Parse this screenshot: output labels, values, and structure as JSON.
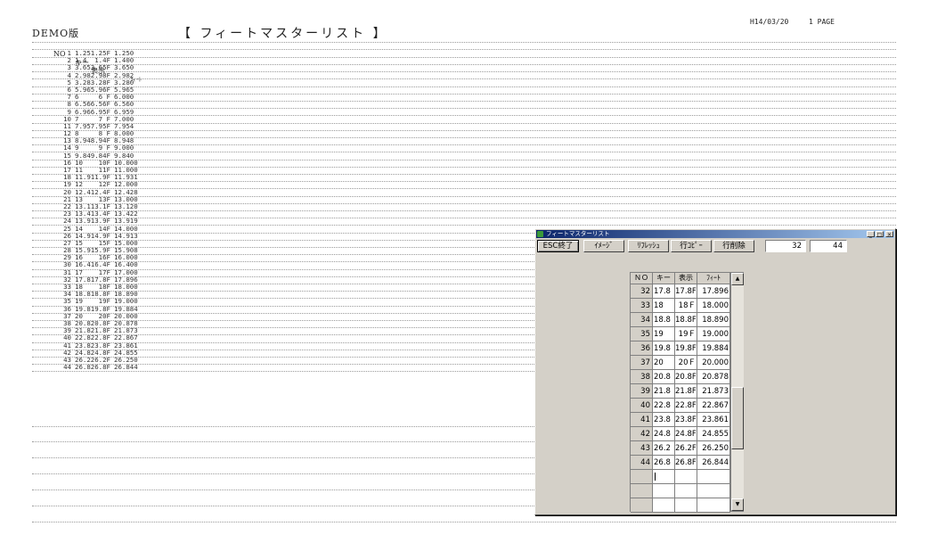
{
  "report": {
    "demo_label": "DEMO版",
    "title": "【 フィートマスターリスト 】",
    "date": "H14/03/20",
    "page": "1 PAGE",
    "headers": {
      "no": "NO",
      "key": "キー",
      "disp": "表示",
      "ft": "ﾌｨｰﾄ"
    },
    "rows": [
      {
        "no": "1",
        "key": "1.25",
        "disp": "1.25F",
        "ft": "1.250"
      },
      {
        "no": "2",
        "key": "1.4",
        "disp": "1.4F",
        "ft": "1.400"
      },
      {
        "no": "3",
        "key": "3.65",
        "disp": "3.65F",
        "ft": "3.650"
      },
      {
        "no": "4",
        "key": "2.98",
        "disp": "2.98F",
        "ft": "2.982"
      },
      {
        "no": "5",
        "key": "3.28",
        "disp": "3.28F",
        "ft": "3.280"
      },
      {
        "no": "6",
        "key": "5.96",
        "disp": "5.96F",
        "ft": "5.965"
      },
      {
        "no": "7",
        "key": "6",
        "disp": "6 F",
        "ft": "6.000"
      },
      {
        "no": "8",
        "key": "6.56",
        "disp": "6.56F",
        "ft": "6.560"
      },
      {
        "no": "9",
        "key": "6.96",
        "disp": "6.95F",
        "ft": "6.959"
      },
      {
        "no": "10",
        "key": "7",
        "disp": "7 F",
        "ft": "7.000"
      },
      {
        "no": "11",
        "key": "7.95",
        "disp": "7.95F",
        "ft": "7.954"
      },
      {
        "no": "12",
        "key": "8",
        "disp": "8 F",
        "ft": "8.000"
      },
      {
        "no": "13",
        "key": "8.94",
        "disp": "8.94F",
        "ft": "8.948"
      },
      {
        "no": "14",
        "key": "9",
        "disp": "9 F",
        "ft": "9.000"
      },
      {
        "no": "15",
        "key": "9.84",
        "disp": "9.84F",
        "ft": "9.840"
      },
      {
        "no": "16",
        "key": "10",
        "disp": "10F",
        "ft": "10.000"
      },
      {
        "no": "17",
        "key": "11",
        "disp": "11F",
        "ft": "11.000"
      },
      {
        "no": "18",
        "key": "11.9",
        "disp": "11.9F",
        "ft": "11.931"
      },
      {
        "no": "19",
        "key": "12",
        "disp": "12F",
        "ft": "12.000"
      },
      {
        "no": "20",
        "key": "12.4",
        "disp": "12.4F",
        "ft": "12.428"
      },
      {
        "no": "21",
        "key": "13",
        "disp": "13F",
        "ft": "13.000"
      },
      {
        "no": "22",
        "key": "13.1",
        "disp": "13.1F",
        "ft": "13.120"
      },
      {
        "no": "23",
        "key": "13.4",
        "disp": "13.4F",
        "ft": "13.422"
      },
      {
        "no": "24",
        "key": "13.9",
        "disp": "13.9F",
        "ft": "13.919"
      },
      {
        "no": "25",
        "key": "14",
        "disp": "14F",
        "ft": "14.000"
      },
      {
        "no": "26",
        "key": "14.9",
        "disp": "14.9F",
        "ft": "14.913"
      },
      {
        "no": "27",
        "key": "15",
        "disp": "15F",
        "ft": "15.000"
      },
      {
        "no": "28",
        "key": "15.9",
        "disp": "15.9F",
        "ft": "15.908"
      },
      {
        "no": "29",
        "key": "16",
        "disp": "16F",
        "ft": "16.000"
      },
      {
        "no": "30",
        "key": "16.4",
        "disp": "16.4F",
        "ft": "16.400"
      },
      {
        "no": "31",
        "key": "17",
        "disp": "17F",
        "ft": "17.000"
      },
      {
        "no": "32",
        "key": "17.8",
        "disp": "17.8F",
        "ft": "17.896"
      },
      {
        "no": "33",
        "key": "18",
        "disp": "18F",
        "ft": "18.000"
      },
      {
        "no": "34",
        "key": "18.8",
        "disp": "18.8F",
        "ft": "18.890"
      },
      {
        "no": "35",
        "key": "19",
        "disp": "19F",
        "ft": "19.000"
      },
      {
        "no": "36",
        "key": "19.8",
        "disp": "19.8F",
        "ft": "19.884"
      },
      {
        "no": "37",
        "key": "20",
        "disp": "20F",
        "ft": "20.000"
      },
      {
        "no": "38",
        "key": "20.8",
        "disp": "20.8F",
        "ft": "20.878"
      },
      {
        "no": "39",
        "key": "21.8",
        "disp": "21.8F",
        "ft": "21.873"
      },
      {
        "no": "40",
        "key": "22.8",
        "disp": "22.8F",
        "ft": "22.867"
      },
      {
        "no": "41",
        "key": "23.8",
        "disp": "23.8F",
        "ft": "23.861"
      },
      {
        "no": "42",
        "key": "24.8",
        "disp": "24.8F",
        "ft": "24.855"
      },
      {
        "no": "43",
        "key": "26.2",
        "disp": "26.2F",
        "ft": "26.250"
      },
      {
        "no": "44",
        "key": "26.8",
        "disp": "26.8F",
        "ft": "26.844"
      }
    ]
  },
  "window": {
    "title": "フィートマスターリスト",
    "app_icon": "app-icon",
    "controls": {
      "minimize": "_",
      "maximize": "□",
      "close": "×"
    },
    "toolbar": {
      "esc_label": "ESC終了",
      "image_label": "ｲﾒｰｼﾞ",
      "refresh_label": "ﾘﾌﾚｯｼｭ",
      "copy_label": "行ｺﾋﾟｰ",
      "delete_label": "行削除",
      "current_row": "32",
      "total_rows": "44"
    },
    "grid": {
      "headers": {
        "no": "ＮＯ",
        "key": "キー",
        "disp": "表示",
        "ft": "ﾌｨｰﾄ"
      },
      "rows": [
        {
          "no": "32",
          "key": "17.8",
          "disp": "17.8F",
          "ft": "17.896"
        },
        {
          "no": "33",
          "key": "18",
          "disp": "18Ｆ",
          "ft": "18.000"
        },
        {
          "no": "34",
          "key": "18.8",
          "disp": "18.8F",
          "ft": "18.890"
        },
        {
          "no": "35",
          "key": "19",
          "disp": "19Ｆ",
          "ft": "19.000"
        },
        {
          "no": "36",
          "key": "19.8",
          "disp": "19.8F",
          "ft": "19.884"
        },
        {
          "no": "37",
          "key": "20",
          "disp": "20Ｆ",
          "ft": "20.000"
        },
        {
          "no": "38",
          "key": "20.8",
          "disp": "20.8F",
          "ft": "20.878"
        },
        {
          "no": "39",
          "key": "21.8",
          "disp": "21.8F",
          "ft": "21.873"
        },
        {
          "no": "40",
          "key": "22.8",
          "disp": "22.8F",
          "ft": "22.867"
        },
        {
          "no": "41",
          "key": "23.8",
          "disp": "23.8F",
          "ft": "23.861"
        },
        {
          "no": "42",
          "key": "24.8",
          "disp": "24.8F",
          "ft": "24.855"
        },
        {
          "no": "43",
          "key": "26.2",
          "disp": "26.2F",
          "ft": "26.250"
        },
        {
          "no": "44",
          "key": "26.8",
          "disp": "26.8F",
          "ft": "26.844"
        }
      ]
    },
    "scrollbar": {
      "up_icon": "scroll-up-arrow-icon",
      "down_icon": "scroll-down-arrow-icon"
    }
  }
}
